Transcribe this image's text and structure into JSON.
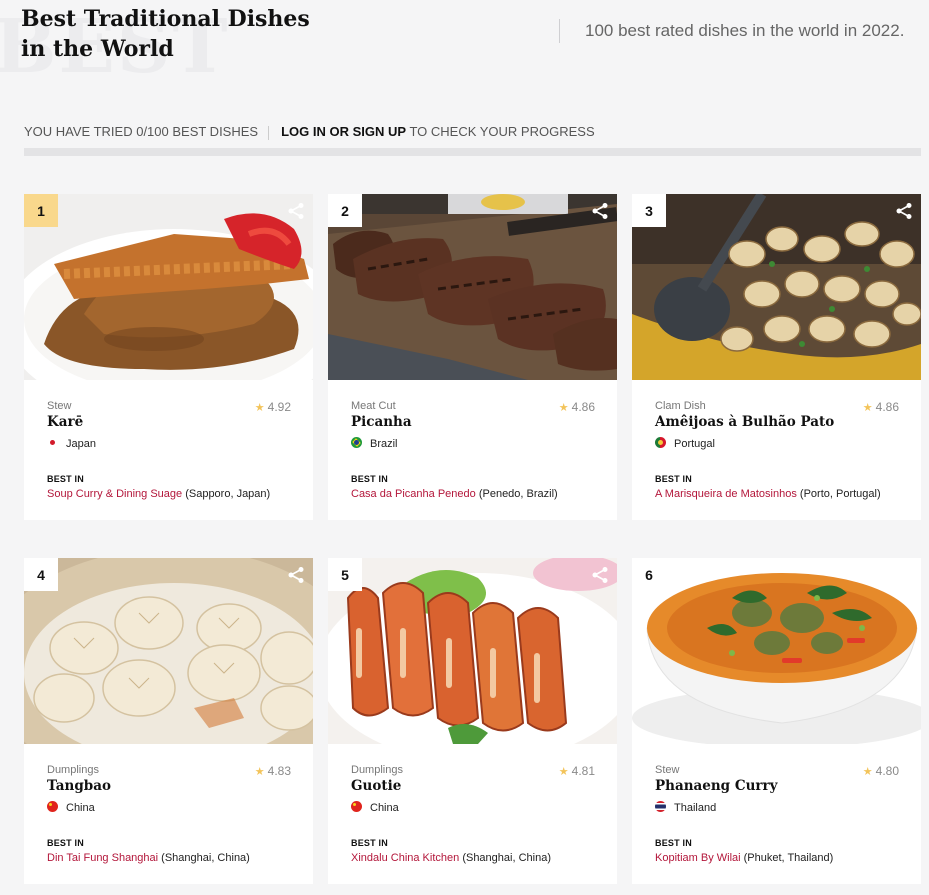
{
  "header": {
    "watermark": "BEST",
    "title": "Best Traditional Dishes in the World",
    "tagline": "100 best rated dishes in the world in 2022."
  },
  "progress": {
    "tried_text": "YOU HAVE TRIED 0/100 BEST DISHES",
    "login_text": "LOG IN OR SIGN UP",
    "suffix_text": "TO CHECK YOUR PROGRESS",
    "fraction": 0
  },
  "colors": {
    "accent": "#b3163a",
    "rank_gold": "#f9d88c",
    "star": "#f3c45a"
  },
  "dishes": [
    {
      "rank": "1",
      "category": "Stew",
      "rating": "4.92",
      "name": "Karē",
      "country": "Japan",
      "best_in_label": "BEST IN",
      "restaurant": "Soup Curry & Dining Suage",
      "location": "(Sapporo, Japan)"
    },
    {
      "rank": "2",
      "category": "Meat Cut",
      "rating": "4.86",
      "name": "Picanha",
      "country": "Brazil",
      "best_in_label": "BEST IN",
      "restaurant": "Casa da Picanha Penedo",
      "location": "(Penedo, Brazil)"
    },
    {
      "rank": "3",
      "category": "Clam Dish",
      "rating": "4.86",
      "name": "Amêijoas à Bulhão Pato",
      "country": "Portugal",
      "best_in_label": "BEST IN",
      "restaurant": "A Marisqueira de Matosinhos",
      "location": "(Porto, Portugal)"
    },
    {
      "rank": "4",
      "category": "Dumplings",
      "rating": "4.83",
      "name": "Tangbao",
      "country": "China",
      "best_in_label": "BEST IN",
      "restaurant": "Din Tai Fung Shanghai",
      "location": "(Shanghai, China)"
    },
    {
      "rank": "5",
      "category": "Dumplings",
      "rating": "4.81",
      "name": "Guotie",
      "country": "China",
      "best_in_label": "BEST IN",
      "restaurant": "Xindalu China Kitchen",
      "location": "(Shanghai, China)"
    },
    {
      "rank": "6",
      "category": "Stew",
      "rating": "4.80",
      "name": "Phanaeng Curry",
      "country": "Thailand",
      "best_in_label": "BEST IN",
      "restaurant": "Kopitiam By Wilai",
      "location": "(Phuket, Thailand)"
    }
  ]
}
